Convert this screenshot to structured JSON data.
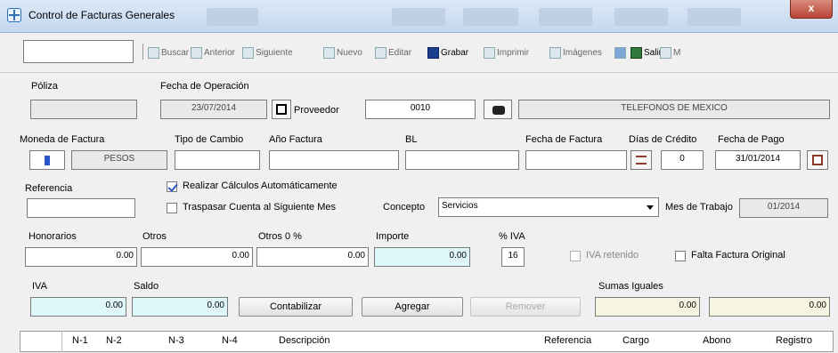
{
  "window": {
    "title": "Control de Facturas Generales",
    "close_label": "x"
  },
  "toolbar": {
    "buttons": [
      {
        "label": "Buscar",
        "icon": "binoculars-icon"
      },
      {
        "label": "Anterior",
        "icon": "arrow-left-icon"
      },
      {
        "label": "Siguiente",
        "icon": "arrow-right-icon"
      },
      {
        "label": "Nuevo",
        "icon": "new-document-icon"
      },
      {
        "label": "Editar",
        "icon": "edit-icon"
      },
      {
        "label": "Grabar",
        "icon": "save-disk-icon"
      },
      {
        "label": "Imprimir",
        "icon": "printer-icon"
      },
      {
        "label": "Imágenes",
        "icon": "images-icon"
      },
      {
        "label": "Salir",
        "icon": "exit-icon"
      },
      {
        "label": "M",
        "icon": "more-icon"
      }
    ]
  },
  "form": {
    "poliza_label": "Póliza",
    "fecha_operacion_label": "Fecha de Operación",
    "fecha_operacion_value": "23/07/2014",
    "proveedor_label": "Proveedor",
    "proveedor_value": "0010",
    "proveedor_name": "TELEFONOS DE MEXICO",
    "moneda_label": "Moneda de Factura",
    "moneda_value": "PESOS",
    "tipo_cambio_label": "Tipo de Cambio",
    "ano_factura_label": "Año Factura",
    "bl_label": "BL",
    "fecha_factura_label": "Fecha de Factura",
    "dias_credito_label": "Días de Crédito",
    "dias_credito_value": "0",
    "fecha_pago_label": "Fecha de Pago",
    "fecha_pago_value": "31/01/2014",
    "referencia_label": "Referencia",
    "realizar_calculos_label": "Realizar Cálculos Automáticamente",
    "traspasar_label": "Traspasar Cuenta al Siguiente Mes",
    "concepto_label": "Concepto",
    "concepto_value": "Servicios",
    "mes_trabajo_label": "Mes de Trabajo",
    "mes_trabajo_value": "01/2014",
    "honorarios_label": "Honorarios",
    "honorarios_value": "0.00",
    "otros_label": "Otros",
    "otros_value": "0.00",
    "otros0_label": "Otros 0 %",
    "otros0_value": "0.00",
    "importe_label": "Importe",
    "importe_value": "0.00",
    "pct_iva_label": "% IVA",
    "pct_iva_value": "16",
    "iva_retenido_label": "IVA retenido",
    "falta_factura_label": "Falta Factura Original",
    "iva_label": "IVA",
    "iva_value": "0.00",
    "saldo_label": "Saldo",
    "saldo_value": "0.00",
    "contabilizar_label": "Contabilizar",
    "agregar_label": "Agregar",
    "remover_label": "Remover",
    "sumas_iguales_label": "Sumas Iguales",
    "sumas_cargo_value": "0.00",
    "sumas_abono_value": "0.00"
  },
  "grid": {
    "columns": [
      "N-1",
      "N-2",
      "N-3",
      "N-4",
      "Descripción",
      "Referencia",
      "Cargo",
      "Abono",
      "Registro"
    ]
  }
}
